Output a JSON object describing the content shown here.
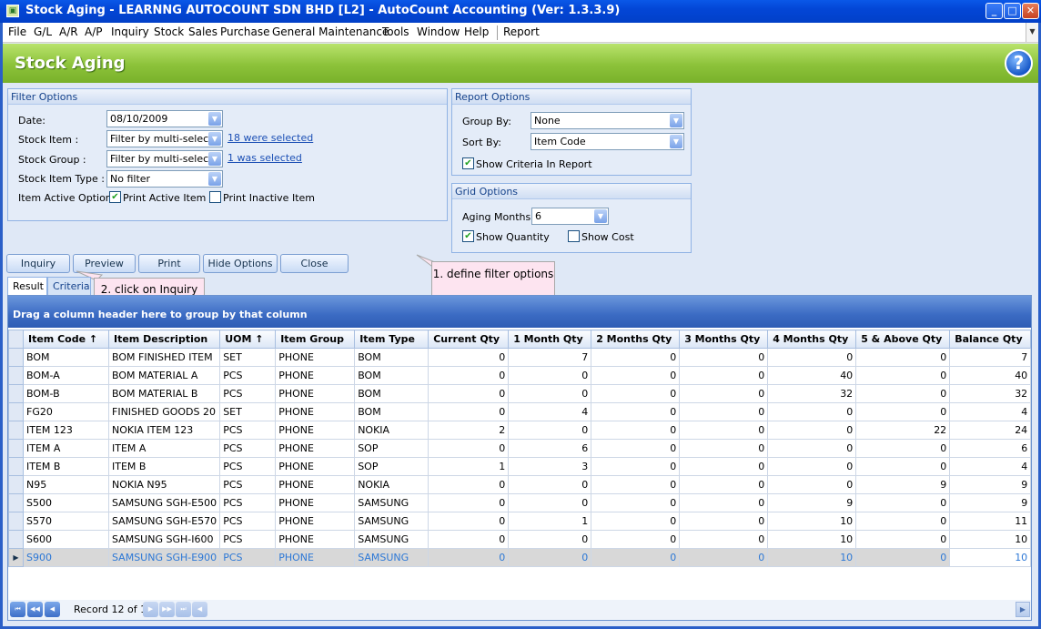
{
  "window": {
    "title": "Stock Aging - LEARNNG AUTOCOUNT SDN BHD [L2] - AutoCount Accounting (Ver: 1.3.3.9)"
  },
  "menu": [
    "File",
    "G/L",
    "A/R",
    "A/P",
    "Inquiry",
    "Stock",
    "Sales",
    "Purchase",
    "General Maintenance",
    "Tools",
    "Window",
    "Help",
    "Report"
  ],
  "page": {
    "title": "Stock Aging"
  },
  "filter_options": {
    "title": "Filter Options",
    "date_label": "Date:",
    "date_value": "08/10/2009",
    "stock_item_label": "Stock Item :",
    "stock_item_value": "Filter by multi-select",
    "stock_item_link": "18 were selected",
    "stock_group_label": "Stock Group :",
    "stock_group_value": "Filter by multi-select",
    "stock_group_link": "1 was selected",
    "stock_item_type_label": "Stock Item Type :",
    "stock_item_type_value": "No filter",
    "item_active_label": "Item Active Option",
    "print_active_label": "Print Active Item",
    "print_active_checked": true,
    "print_inactive_label": "Print Inactive Item",
    "print_inactive_checked": false
  },
  "report_options": {
    "title": "Report Options",
    "group_by_label": "Group By:",
    "group_by_value": "None",
    "sort_by_label": "Sort By:",
    "sort_by_value": "Item Code",
    "show_criteria_label": "Show Criteria In Report",
    "show_criteria_checked": true
  },
  "grid_options": {
    "title": "Grid Options",
    "aging_months_label": "Aging Months",
    "aging_months_value": "6",
    "show_quantity_label": "Show Quantity",
    "show_quantity_checked": true,
    "show_cost_label": "Show Cost",
    "show_cost_checked": false
  },
  "buttons": {
    "inquiry": "Inquiry",
    "preview": "Preview",
    "print": "Print",
    "hide_options": "Hide Options",
    "close": "Close"
  },
  "callouts": {
    "define": "1. define filter options",
    "click": "2. click on Inquiry"
  },
  "tabs": {
    "result": "Result",
    "criteria": "Criteria"
  },
  "grid": {
    "group_panel_text": "Drag a column header here to group by that column",
    "columns": [
      "Item Code",
      "Item Description",
      "UOM",
      "Item Group",
      "Item Type",
      "Current Qty",
      "1 Month Qty",
      "2 Months Qty",
      "3 Months Qty",
      "4 Months Qty",
      "5 & Above Qty",
      "Balance Qty"
    ],
    "sort_indicator": "↑",
    "rows": [
      [
        "BOM",
        "BOM FINISHED ITEM",
        "SET",
        "PHONE",
        "BOM",
        "0",
        "7",
        "0",
        "0",
        "0",
        "0",
        "7"
      ],
      [
        "BOM-A",
        "BOM MATERIAL A",
        "PCS",
        "PHONE",
        "BOM",
        "0",
        "0",
        "0",
        "0",
        "40",
        "0",
        "40"
      ],
      [
        "BOM-B",
        "BOM MATERIAL B",
        "PCS",
        "PHONE",
        "BOM",
        "0",
        "0",
        "0",
        "0",
        "32",
        "0",
        "32"
      ],
      [
        "FG20",
        "FINISHED GOODS 20",
        "SET",
        "PHONE",
        "BOM",
        "0",
        "4",
        "0",
        "0",
        "0",
        "0",
        "4"
      ],
      [
        "ITEM 123",
        "NOKIA ITEM 123",
        "PCS",
        "PHONE",
        "NOKIA",
        "2",
        "0",
        "0",
        "0",
        "0",
        "22",
        "24"
      ],
      [
        "ITEM A",
        "ITEM A",
        "PCS",
        "PHONE",
        "SOP",
        "0",
        "6",
        "0",
        "0",
        "0",
        "0",
        "6"
      ],
      [
        "ITEM B",
        "ITEM B",
        "PCS",
        "PHONE",
        "SOP",
        "1",
        "3",
        "0",
        "0",
        "0",
        "0",
        "4"
      ],
      [
        "N95",
        "NOKIA N95",
        "PCS",
        "PHONE",
        "NOKIA",
        "0",
        "0",
        "0",
        "0",
        "0",
        "9",
        "9"
      ],
      [
        "S500",
        "SAMSUNG SGH-E500",
        "PCS",
        "PHONE",
        "SAMSUNG",
        "0",
        "0",
        "0",
        "0",
        "9",
        "0",
        "9"
      ],
      [
        "S570",
        "SAMSUNG SGH-E570",
        "PCS",
        "PHONE",
        "SAMSUNG",
        "0",
        "1",
        "0",
        "0",
        "10",
        "0",
        "11"
      ],
      [
        "S600",
        "SAMSUNG SGH-I600",
        "PCS",
        "PHONE",
        "SAMSUNG",
        "0",
        "0",
        "0",
        "0",
        "10",
        "0",
        "10"
      ],
      [
        "S900",
        "SAMSUNG SGH-E900",
        "PCS",
        "PHONE",
        "SAMSUNG",
        "0",
        "0",
        "0",
        "0",
        "10",
        "0",
        "10"
      ]
    ],
    "selected_row": 11,
    "record_text": "Record 12 of 12"
  }
}
